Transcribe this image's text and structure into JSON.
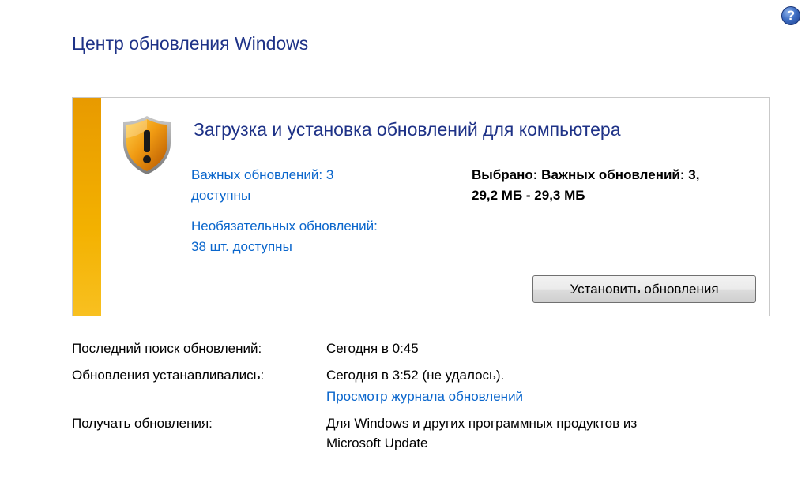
{
  "header": {
    "title": "Центр обновления Windows",
    "help_glyph": "?"
  },
  "status_panel": {
    "icon": "warning-shield-icon",
    "accent_color": "#f3b100",
    "heading": "Загрузка и установка обновлений для компьютера",
    "important_updates": {
      "line1": "Важных обновлений: 3",
      "line2": "доступны"
    },
    "optional_updates": {
      "line1": "Необязательных обновлений:",
      "line2": "38 шт. доступны"
    },
    "selected": {
      "line1": "Выбрано: Важных обновлений: 3,",
      "line2": "29,2 МБ - 29,3 МБ"
    },
    "install_button": "Установить обновления"
  },
  "info": {
    "last_check_label": "Последний поиск обновлений:",
    "last_check_value": "Сегодня в 0:45",
    "installed_label": "Обновления устанавливались:",
    "installed_value": "Сегодня в 3:52 (не удалось).",
    "history_link": "Просмотр журнала обновлений",
    "receive_label": "Получать обновления:",
    "receive_value_line1": "Для Windows и других программных продуктов из",
    "receive_value_line2": "Microsoft Update"
  }
}
